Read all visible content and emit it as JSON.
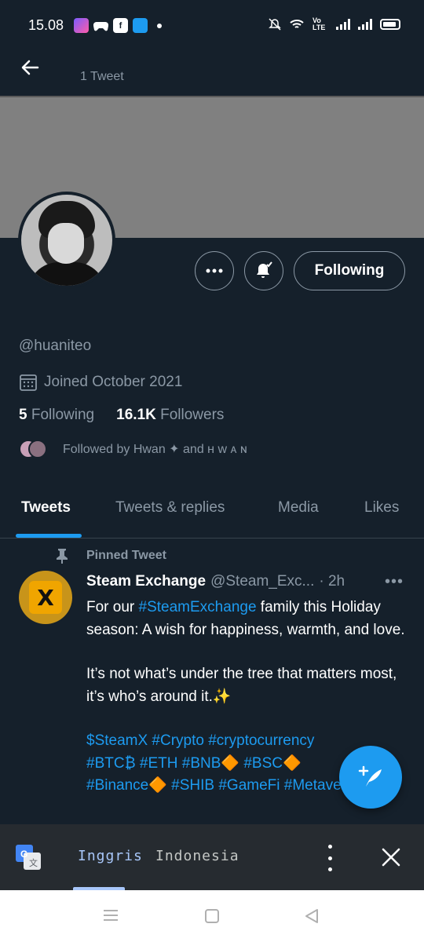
{
  "statusbar": {
    "time": "15.08",
    "network_label": "Vo LTE"
  },
  "header": {
    "tweet_count": "1 Tweet"
  },
  "profile": {
    "handle": "@huaniteo",
    "joined": "Joined October 2021",
    "following_count": "5",
    "following_label": "Following",
    "followers_count": "16.1K",
    "followers_label": "Followers",
    "followed_by": "Followed by Hwan ✦ and ʜ ᴡ ᴀ ɴ",
    "follow_button": "Following"
  },
  "tabs": [
    {
      "label": "Tweets",
      "active": true
    },
    {
      "label": "Tweets & replies",
      "active": false
    },
    {
      "label": "Media",
      "active": false
    },
    {
      "label": "Likes",
      "active": false
    }
  ],
  "tweet": {
    "pinned_label": "Pinned Tweet",
    "author_name": "Steam Exchange",
    "author_handle": "@Steam_Exc...",
    "time": "· 2h",
    "more": "•••",
    "avatar_letter": "X",
    "line1_pre": "For our ",
    "line1_tag": "#SteamExchange",
    "line1_post": " family this Holiday season: A wish for happiness, warmth, and love.",
    "paragraph2": "It’s not what’s under the tree that matters most, it’s who’s around it.✨",
    "tags_line1": "$SteamX #Crypto #cryptocurrency",
    "tags_line2": "#BTC₿  #ETH #BNB🔶 #BSC🔶",
    "tags_line3": "#Binance🔶 #SHIB #GameFi #Metaverse"
  },
  "translate_bar": {
    "lang_source": "Inggris",
    "lang_target": "Indonesia"
  },
  "colors": {
    "background": "#15202b",
    "accent": "#1d9bf0",
    "secondary_text": "#8b98a5"
  }
}
